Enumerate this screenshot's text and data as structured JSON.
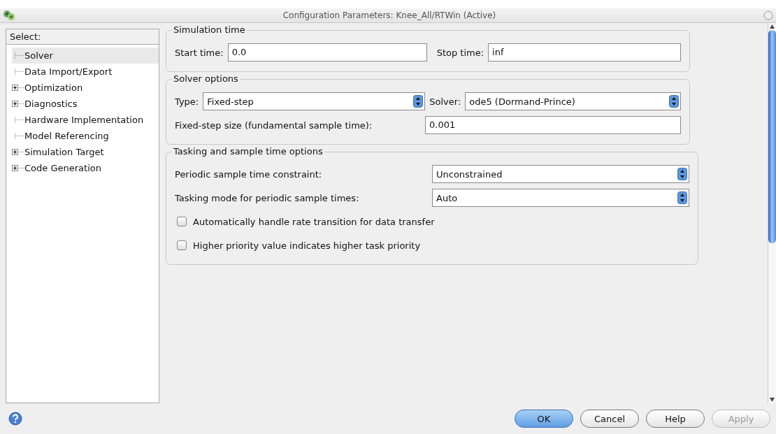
{
  "window": {
    "title": "Configuration Parameters: Knee_All/RTWin (Active)"
  },
  "tree": {
    "header": "Select:",
    "items": [
      {
        "label": "Solver",
        "kind": "leaf",
        "selected": true
      },
      {
        "label": "Data Import/Export",
        "kind": "leaf",
        "selected": false
      },
      {
        "label": "Optimization",
        "kind": "branch",
        "selected": false
      },
      {
        "label": "Diagnostics",
        "kind": "branch",
        "selected": false
      },
      {
        "label": "Hardware Implementation",
        "kind": "leaf",
        "selected": false
      },
      {
        "label": "Model Referencing",
        "kind": "leaf",
        "selected": false
      },
      {
        "label": "Simulation Target",
        "kind": "branch",
        "selected": false
      },
      {
        "label": "Code Generation",
        "kind": "branch",
        "selected": false
      }
    ]
  },
  "simulation_time": {
    "title": "Simulation time",
    "start_label": "Start time:",
    "start_value": "0.0",
    "stop_label": "Stop time:",
    "stop_value": "inf"
  },
  "solver_options": {
    "title": "Solver options",
    "type_label": "Type:",
    "type_value": "Fixed-step",
    "solver_label": "Solver:",
    "solver_value": "ode5 (Dormand-Prince)",
    "step_label": "Fixed-step size (fundamental sample time):",
    "step_value": "0.001"
  },
  "tasking": {
    "title": "Tasking and sample time options",
    "rows": [
      {
        "label": "Periodic sample time constraint:",
        "value": "Unconstrained"
      },
      {
        "label": "Tasking mode for periodic sample times:",
        "value": "Auto"
      }
    ],
    "checkboxes": [
      {
        "label": "Automatically handle rate transition for data transfer",
        "checked": false
      },
      {
        "label": "Higher priority value indicates higher task priority",
        "checked": false
      }
    ]
  },
  "buttons": [
    {
      "label": "OK",
      "kind": "default",
      "disabled": false
    },
    {
      "label": "Cancel",
      "kind": "normal",
      "disabled": false
    },
    {
      "label": "Help",
      "kind": "normal",
      "disabled": false
    },
    {
      "label": "Apply",
      "kind": "normal",
      "disabled": true
    }
  ]
}
